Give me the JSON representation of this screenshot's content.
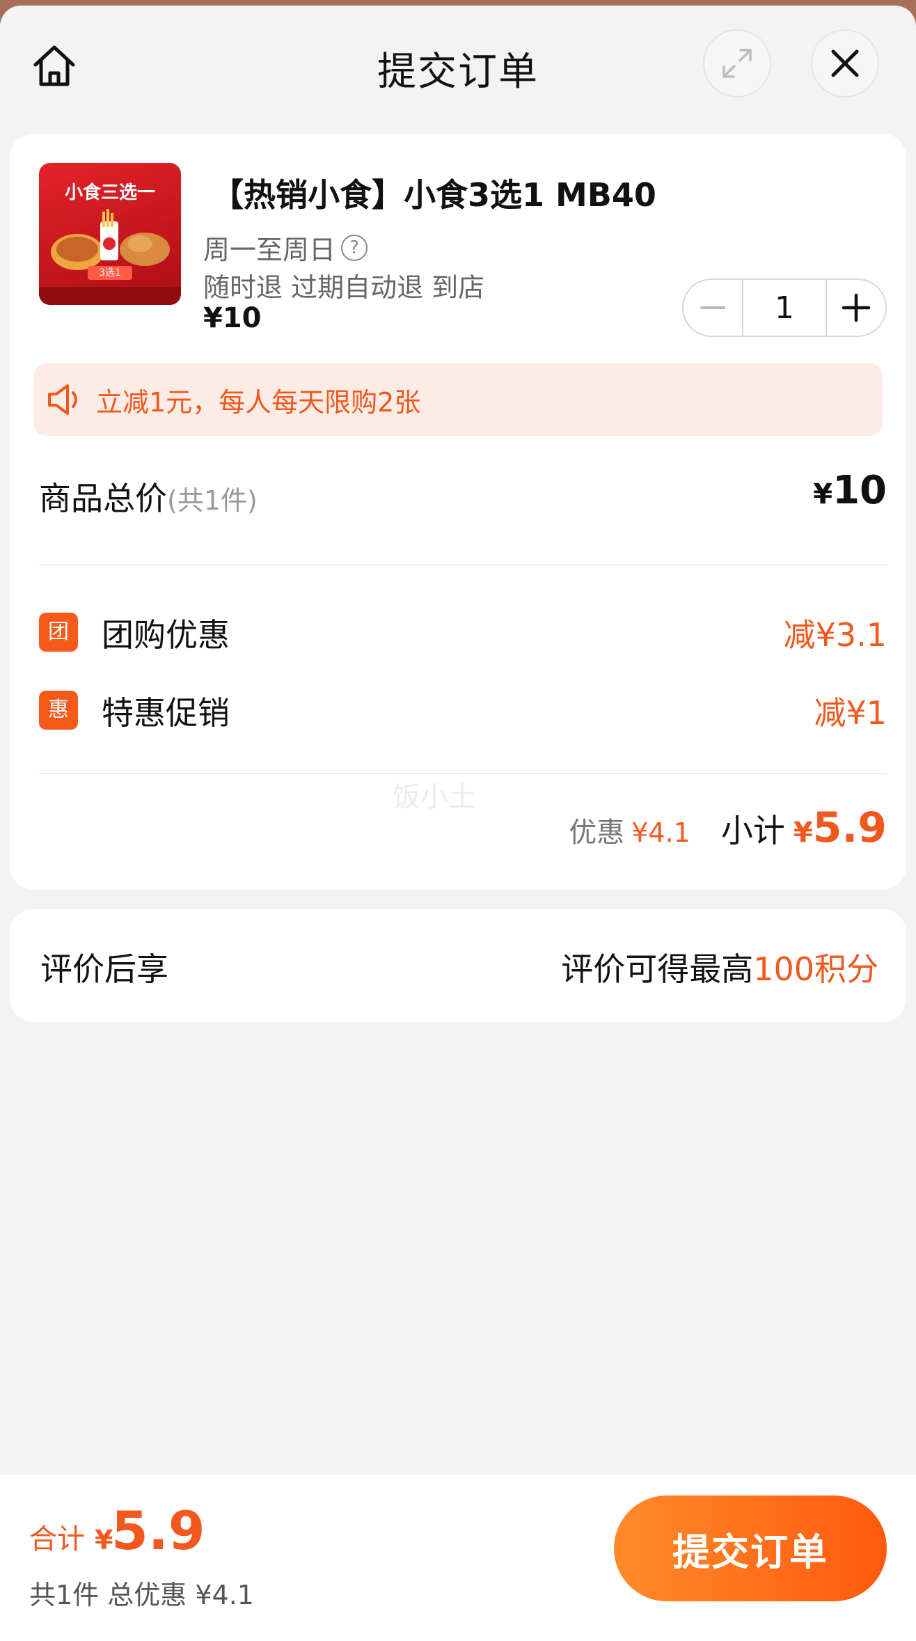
{
  "header": {
    "title": "提交订单"
  },
  "product": {
    "thumb_title": "小食三选一",
    "thumb_badge": "3选1",
    "name": "【热销小食】小食3选1 MB40",
    "days": "周一至周日",
    "refund": "随时退 过期自动退 到店",
    "price": "¥10",
    "quantity": "1"
  },
  "notice": {
    "text": "立减1元，每人每天限购2张"
  },
  "total": {
    "label": "商品总价",
    "count": "(共1件)",
    "yen": "¥",
    "value": "10"
  },
  "discounts": [
    {
      "badge": "团",
      "label": "团购优惠",
      "value": "减¥3.1"
    },
    {
      "badge": "惠",
      "label": "特惠促销",
      "value": "减¥1"
    }
  ],
  "watermark": "饭小土",
  "subtotal": {
    "save_label": "优惠",
    "save_value": "¥4.1",
    "label": "小计",
    "yen": "¥",
    "value": "5.9"
  },
  "review": {
    "left": "评价后享",
    "right_prefix": "评价可得最高",
    "right_highlight": "100积分"
  },
  "bottom": {
    "sum_label": "合计",
    "sum_yen": "¥",
    "sum_value": "5.9",
    "sum_desc": "共1件 总优惠 ¥4.1",
    "submit_label": "提交订单"
  },
  "colors": {
    "accent": "#f0581e",
    "notice_bg": "#fdece6"
  }
}
